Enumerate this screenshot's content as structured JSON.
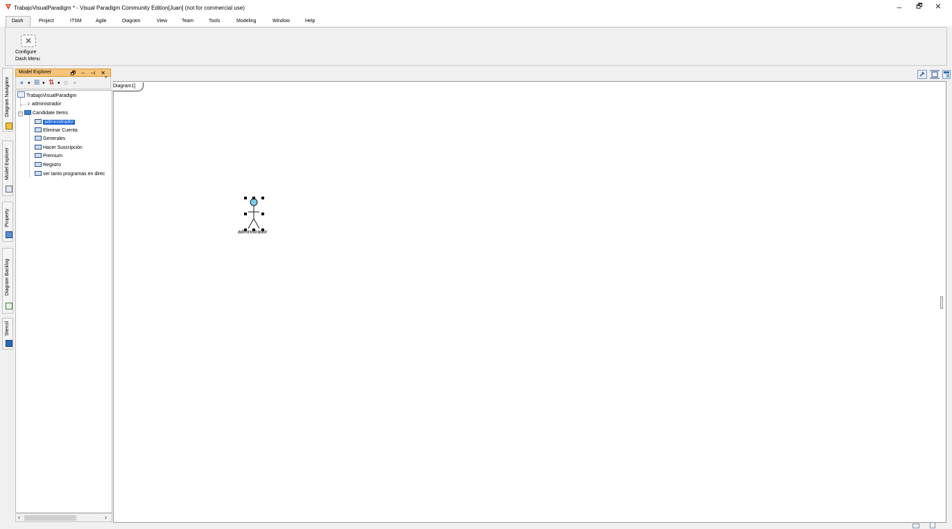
{
  "window": {
    "title": "TrabajoVisualParadigm * - Visual Paradigm Community Edition[Juan] (not for commercial use)",
    "minimize": "–",
    "maximize": "🗗",
    "close": "✕"
  },
  "menu": {
    "items": [
      "Dash",
      "Project",
      "ITSM",
      "Agile",
      "Diagram",
      "View",
      "Team",
      "Tools",
      "Modeling",
      "Window",
      "Help"
    ]
  },
  "ribbon": {
    "configure_line1": "Configure",
    "configure_line2": "Dash Menu"
  },
  "left_tabs": {
    "items": [
      "Diagram Navigator",
      "Model Explorer",
      "Property",
      "Diagram Backlog",
      "Stencil"
    ]
  },
  "model_explorer": {
    "title": "Model Explorer",
    "header_buttons": "🗗 – ⊣ ✕",
    "tree": {
      "project": "TrabajoVisualParadigm",
      "actor": "administrador",
      "folder": "Candidate Items",
      "children": [
        "administrador",
        "Eliminar Cuenta",
        "Generales",
        "Hacer Suscripción",
        "Premium",
        "Registro",
        "ver tanto programas en direc"
      ]
    }
  },
  "canvas": {
    "diagram_tab": "Diagram1]",
    "actor_label": "administrador"
  },
  "colors": {
    "panel_header": "#f5c37a",
    "selection": "#0a5bd6",
    "actor_head": "#7ec8ee"
  }
}
